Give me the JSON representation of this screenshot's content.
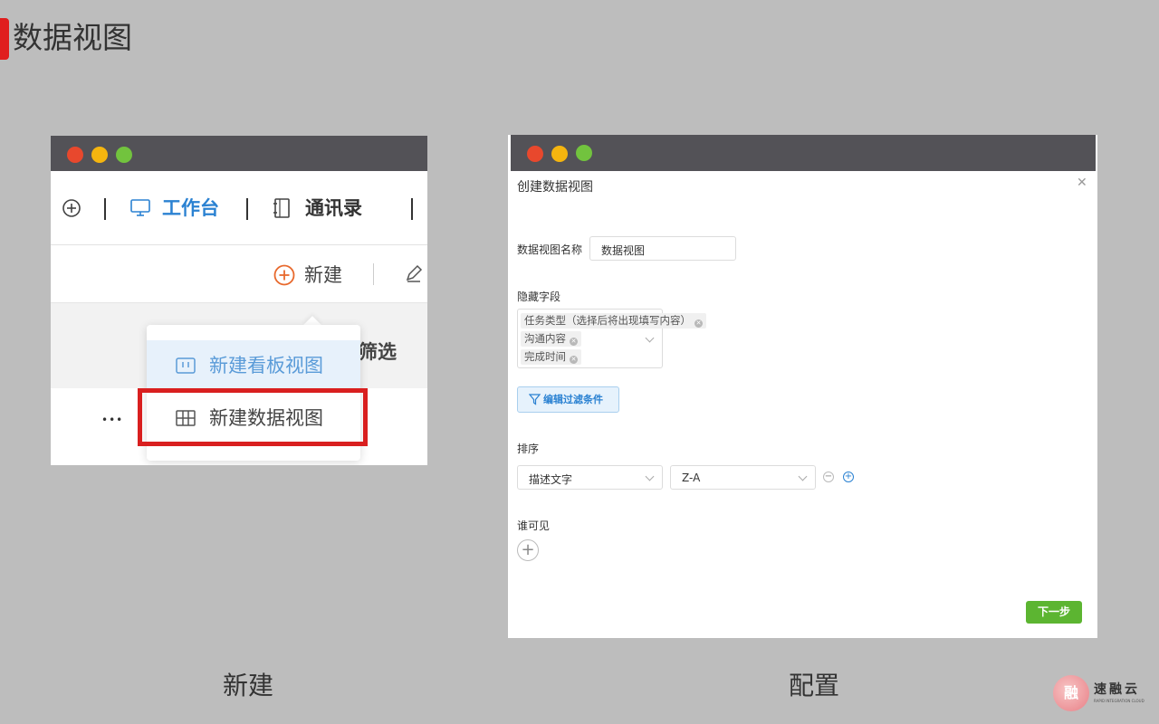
{
  "page": {
    "title": "数据视图"
  },
  "colors": {
    "accent": "#e01e1e",
    "primary_blue": "#2b82d2",
    "green_button": "#5cb531",
    "highlight_red": "#d91f1f"
  },
  "left_window": {
    "nav": {
      "workbench_label": "工作台",
      "contacts_label": "通讯录"
    },
    "toolbar": {
      "new_label": "新建"
    },
    "filter_label": "筛选",
    "more_label": "•••",
    "dropdown": {
      "items": [
        {
          "label": "新建看板视图",
          "icon": "kanban-icon"
        },
        {
          "label": "新建数据视图",
          "icon": "table-icon"
        }
      ]
    }
  },
  "right_window": {
    "dialog": {
      "title": "创建数据视图",
      "name_label": "数据视图名称",
      "name_value": "数据视图",
      "hidden_fields_label": "隐藏字段",
      "hidden_fields": [
        "任务类型（选择后将出现填写内容）",
        "沟通内容",
        "完成时间"
      ],
      "edit_filter_label": "编辑过滤条件",
      "sort_label": "排序",
      "sort_field": "描述文字",
      "sort_order": "Z-A",
      "visible_label": "谁可见",
      "next_label": "下一步"
    }
  },
  "captions": {
    "left": "新建",
    "right": "配置"
  },
  "logo": {
    "name": "速融云",
    "subtitle": "RAPID INTEGRATION CLOUD",
    "mark_char": "融"
  }
}
